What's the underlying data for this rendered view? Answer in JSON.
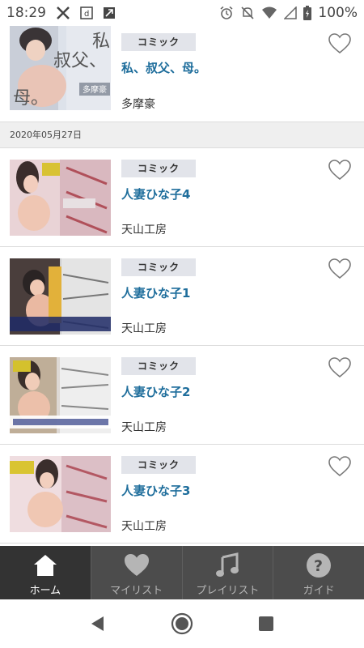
{
  "status_bar": {
    "time": "18:29",
    "battery": "100%",
    "icons": [
      "x-icon",
      "d-app-icon",
      "tool-icon",
      "alarm-icon",
      "mute-icon",
      "wifi-icon",
      "signal-icon",
      "battery-icon"
    ]
  },
  "items": [
    {
      "badge": "コミック",
      "title": "私、叔父、母。",
      "author": "多摩豪",
      "cover_text": [
        "私、",
        "叔父、",
        "母。"
      ],
      "cover_author": "多摩豪"
    },
    {
      "badge": "コミック",
      "title": "人妻ひな子4",
      "author": "天山工房"
    },
    {
      "badge": "コミック",
      "title": "人妻ひな子1",
      "author": "天山工房"
    },
    {
      "badge": "コミック",
      "title": "人妻ひな子2",
      "author": "天山工房"
    },
    {
      "badge": "コミック",
      "title": "人妻ひな子3",
      "author": "天山工房"
    }
  ],
  "date_header": "2020年05月27日",
  "bottom_nav": [
    {
      "label": "ホーム",
      "icon": "home-icon",
      "active": true
    },
    {
      "label": "マイリスト",
      "icon": "heart-icon",
      "active": false
    },
    {
      "label": "プレイリスト",
      "icon": "music-note-icon",
      "active": false
    },
    {
      "label": "ガイド",
      "icon": "help-icon",
      "active": false
    }
  ],
  "system_nav": [
    "back-icon",
    "home-circle-icon",
    "recents-icon"
  ],
  "colors": {
    "title": "#1f6e9c",
    "badge_bg": "#e2e4ea",
    "nav_bg": "#4c4c4c",
    "nav_active": "#333333"
  }
}
